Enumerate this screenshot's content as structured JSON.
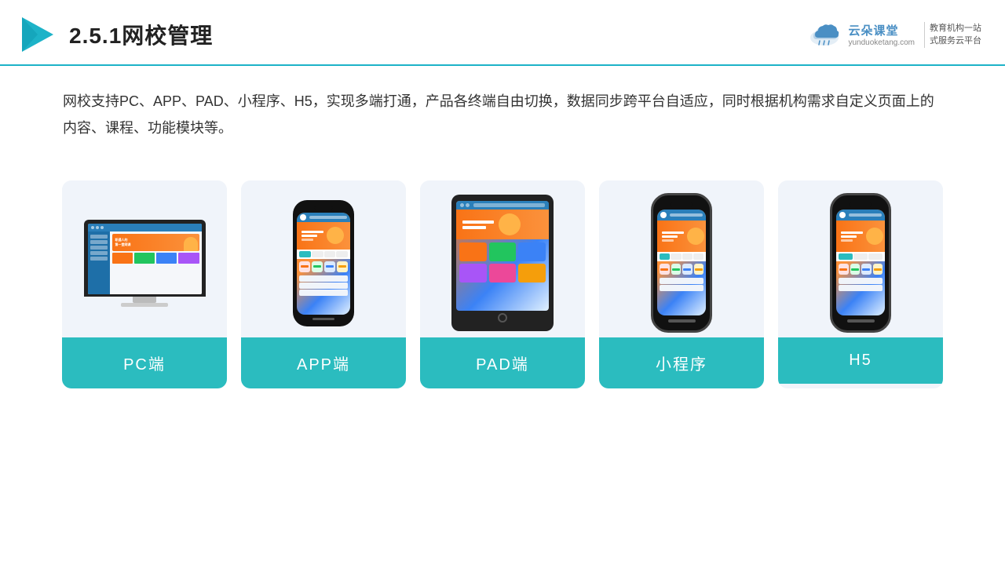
{
  "header": {
    "title": "2.5.1网校管理",
    "brand": {
      "name": "云朵课堂",
      "url": "yunduoketang.com",
      "slogan": "教育机构一站\n式服务云平台"
    }
  },
  "description": "网校支持PC、APP、PAD、小程序、H5，实现多端打通，产品各终端自由切换，数据同步跨平台自适应，同时根据机构需求自定义页面上的内容、课程、功能模块等。",
  "cards": [
    {
      "id": "pc",
      "label": "PC端"
    },
    {
      "id": "app",
      "label": "APP端"
    },
    {
      "id": "pad",
      "label": "PAD端"
    },
    {
      "id": "miniprogram",
      "label": "小程序"
    },
    {
      "id": "h5",
      "label": "H5"
    }
  ],
  "colors": {
    "accent": "#2bbcbf",
    "border": "#1db3c8",
    "card_bg": "#f0f4fa"
  }
}
